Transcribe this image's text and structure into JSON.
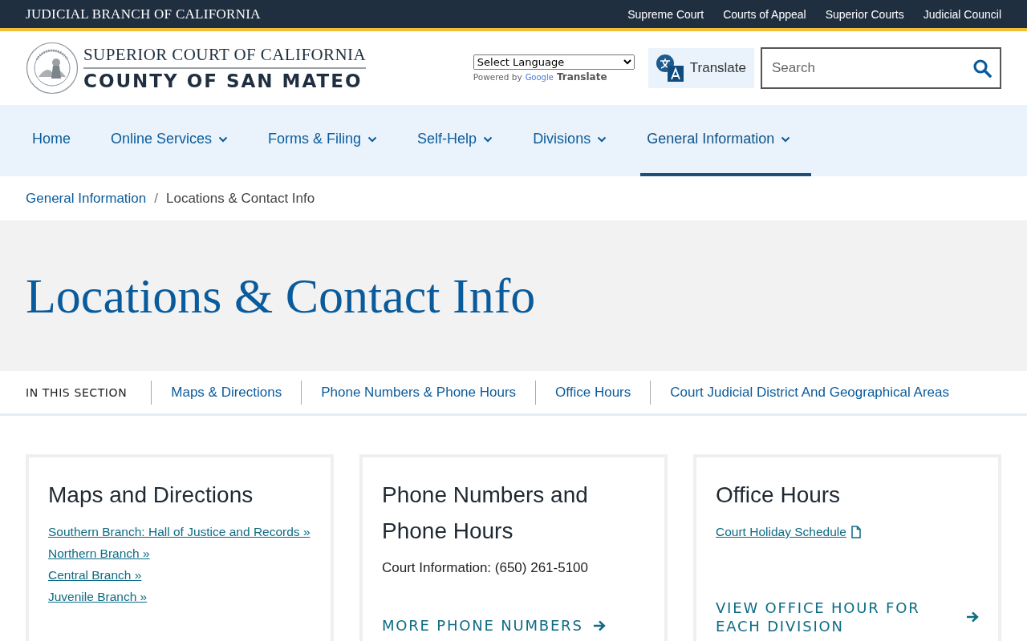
{
  "top_bar": {
    "brand": "JUDICIAL BRANCH OF CALIFORNIA",
    "links": [
      "Supreme Court",
      "Courts of Appeal",
      "Superior Courts",
      "Judicial Council"
    ]
  },
  "header": {
    "title_line_1": "SUPERIOR COURT OF CALIFORNIA",
    "title_line_2": "COUNTY OF SAN MATEO",
    "language_select": "Select Language",
    "powered_by": "Powered by",
    "google": "Google",
    "translate_word": "Translate",
    "translate_button": "Translate",
    "search": {
      "placeholder": "Search"
    }
  },
  "nav": [
    {
      "label": "Home",
      "has_menu": false,
      "selected": false
    },
    {
      "label": "Online Services",
      "has_menu": true,
      "selected": false
    },
    {
      "label": "Forms & Filing",
      "has_menu": true,
      "selected": false
    },
    {
      "label": "Self-Help",
      "has_menu": true,
      "selected": false
    },
    {
      "label": "Divisions",
      "has_menu": true,
      "selected": false
    },
    {
      "label": "General Information",
      "has_menu": true,
      "selected": true
    }
  ],
  "breadcrumb_separator": "/",
  "breadcrumb": [
    {
      "label": "General Information",
      "kind": "link"
    },
    {
      "label": "Locations & Contact Info",
      "kind": "current"
    }
  ],
  "page_title": "Locations & Contact Info",
  "section_nav": {
    "label": "IN THIS SECTION",
    "links": [
      "Maps & Directions",
      "Phone Numbers & Phone Hours",
      "Office Hours",
      "Court Judicial District And Geographical Areas"
    ]
  },
  "cards": [
    {
      "title": "Maps and Directions",
      "links": [
        {
          "text": "Southern Branch: Hall of Justice and Records »",
          "document": false
        },
        {
          "text": "Northern Branch »",
          "document": false
        },
        {
          "text": "Central Branch »",
          "document": false
        },
        {
          "text": "Juvenile Branch »",
          "document": false
        }
      ]
    },
    {
      "title": "Phone Numbers and Phone Hours",
      "text": "Court Information: (650) 261-5100",
      "action": "MORE PHONE NUMBERS"
    },
    {
      "title": "Office Hours",
      "links": [
        {
          "text": "Court Holiday Schedule",
          "document": true
        }
      ],
      "action": "VIEW OFFICE HOUR FOR EACH DIVISION"
    }
  ]
}
